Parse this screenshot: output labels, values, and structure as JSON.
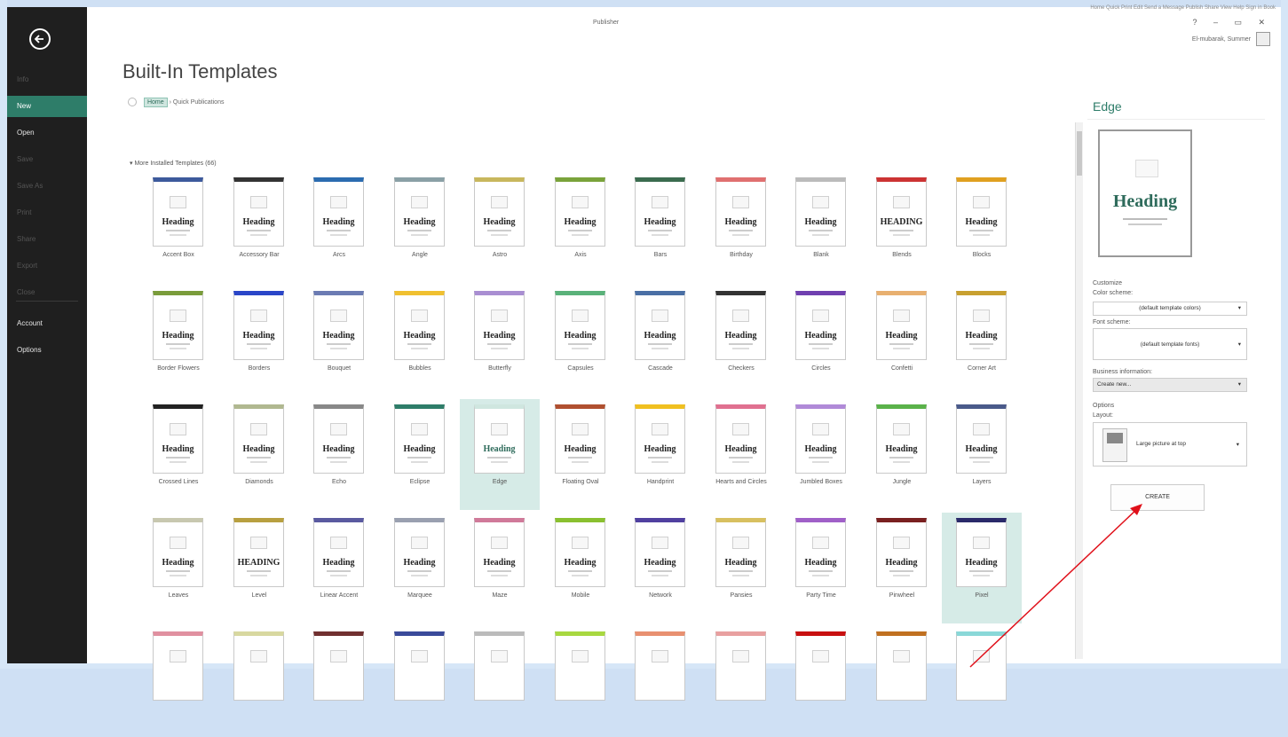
{
  "window": {
    "app_title": "Publisher",
    "top_links": "Home Quick Print Edit Send a Message Publish Share View Help Sign in Book",
    "controls": "? – ▭ ✕",
    "user_name": "El-mubarak, Summer"
  },
  "nav": {
    "items": [
      {
        "label": "Info",
        "state": "disabled"
      },
      {
        "label": "New",
        "state": "active"
      },
      {
        "label": "Open",
        "state": "enabled"
      },
      {
        "label": "Save",
        "state": "disabled"
      },
      {
        "label": "Save As",
        "state": "disabled"
      },
      {
        "label": "Print",
        "state": "disabled"
      },
      {
        "label": "Share",
        "state": "disabled"
      },
      {
        "label": "Export",
        "state": "disabled"
      },
      {
        "label": "Close",
        "state": "disabled"
      },
      {
        "label": "Account",
        "state": "enabled"
      },
      {
        "label": "Options",
        "state": "enabled"
      }
    ]
  },
  "page": {
    "title": "Built-In Templates",
    "breadcrumb_home": "Home",
    "breadcrumb_sep": "›",
    "breadcrumb_current": "Quick Publications",
    "section_label": "▾ More Installed Templates (66)"
  },
  "templates": [
    {
      "name": "Accent Box",
      "heading": "Heading"
    },
    {
      "name": "Accessory Bar",
      "heading": "Heading"
    },
    {
      "name": "Arcs",
      "heading": "Heading"
    },
    {
      "name": "Angle",
      "heading": "Heading"
    },
    {
      "name": "Astro",
      "heading": "Heading"
    },
    {
      "name": "Axis",
      "heading": "Heading"
    },
    {
      "name": "Bars",
      "heading": "Heading"
    },
    {
      "name": "Birthday",
      "heading": "Heading"
    },
    {
      "name": "Blank",
      "heading": "Heading"
    },
    {
      "name": "Blends",
      "heading": "HEADING"
    },
    {
      "name": "Blocks",
      "heading": "Heading"
    },
    {
      "name": "Border Flowers",
      "heading": "Heading"
    },
    {
      "name": "Borders",
      "heading": "Heading"
    },
    {
      "name": "Bouquet",
      "heading": "Heading"
    },
    {
      "name": "Bubbles",
      "heading": "Heading"
    },
    {
      "name": "Butterfly",
      "heading": "Heading"
    },
    {
      "name": "Capsules",
      "heading": "Heading"
    },
    {
      "name": "Cascade",
      "heading": "Heading"
    },
    {
      "name": "Checkers",
      "heading": "Heading"
    },
    {
      "name": "Circles",
      "heading": "Heading"
    },
    {
      "name": "Confetti",
      "heading": "Heading"
    },
    {
      "name": "Corner Art",
      "heading": "Heading"
    },
    {
      "name": "Crossed Lines",
      "heading": "Heading"
    },
    {
      "name": "Diamonds",
      "heading": "Heading"
    },
    {
      "name": "Echo",
      "heading": "Heading"
    },
    {
      "name": "Eclipse",
      "heading": "Heading"
    },
    {
      "name": "Edge",
      "heading": "Heading"
    },
    {
      "name": "Floating Oval",
      "heading": "Heading"
    },
    {
      "name": "Handprint",
      "heading": "Heading"
    },
    {
      "name": "Hearts and Circles",
      "heading": "Heading"
    },
    {
      "name": "Jumbled Boxes",
      "heading": "Heading"
    },
    {
      "name": "Jungle",
      "heading": "Heading"
    },
    {
      "name": "Layers",
      "heading": "Heading"
    },
    {
      "name": "Leaves",
      "heading": "Heading"
    },
    {
      "name": "Level",
      "heading": "HEADING"
    },
    {
      "name": "Linear Accent",
      "heading": "Heading"
    },
    {
      "name": "Marquee",
      "heading": "Heading"
    },
    {
      "name": "Maze",
      "heading": "Heading"
    },
    {
      "name": "Mobile",
      "heading": "Heading"
    },
    {
      "name": "Network",
      "heading": "Heading"
    },
    {
      "name": "Pansies",
      "heading": "Heading"
    },
    {
      "name": "Party Time",
      "heading": "Heading"
    },
    {
      "name": "Pinwheel",
      "heading": "Heading"
    },
    {
      "name": "Pixel",
      "heading": "Heading"
    },
    {
      "name": "",
      "heading": ""
    },
    {
      "name": "",
      "heading": ""
    },
    {
      "name": "",
      "heading": ""
    },
    {
      "name": "",
      "heading": ""
    },
    {
      "name": "",
      "heading": ""
    },
    {
      "name": "",
      "heading": ""
    },
    {
      "name": "",
      "heading": ""
    },
    {
      "name": "",
      "heading": ""
    },
    {
      "name": "",
      "heading": ""
    },
    {
      "name": "",
      "heading": ""
    },
    {
      "name": "",
      "heading": ""
    }
  ],
  "selected_templates": [
    "Edge",
    "Pixel"
  ],
  "panel": {
    "template_name": "Edge",
    "preview_heading": "Heading",
    "customize_label": "Customize",
    "color_scheme_label": "Color scheme:",
    "color_scheme_value": "(default template colors)",
    "font_scheme_label": "Font scheme:",
    "font_scheme_value": "(default template fonts)",
    "business_info_label": "Business information:",
    "business_info_value": "Create new...",
    "options_label": "Options",
    "layout_label": "Layout:",
    "layout_value": "Large picture at top",
    "create_label": "CREATE",
    "caret": "▾"
  },
  "colors": {
    "accent": "#2e7d69",
    "nav_bg": "#1f1f1f",
    "selected_tile": "#d6ebe7",
    "annotation_arrow": "#e0101a"
  }
}
